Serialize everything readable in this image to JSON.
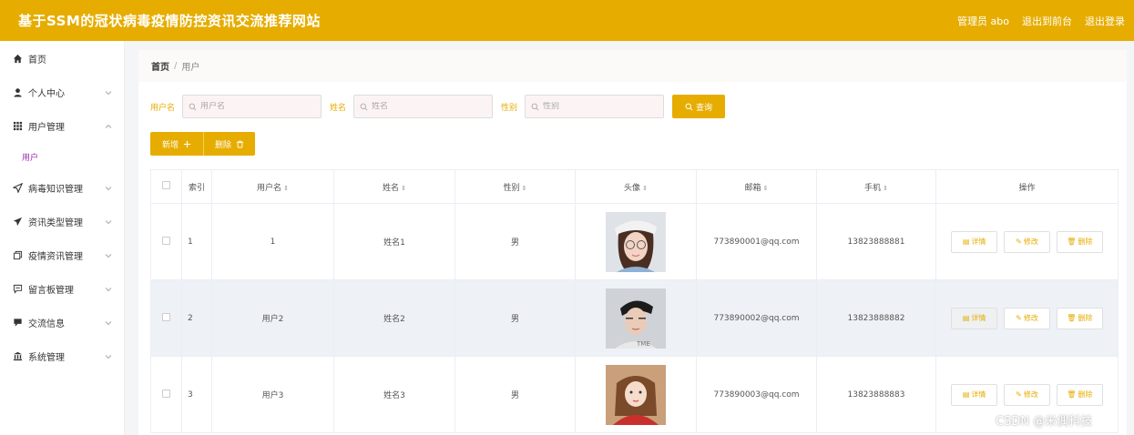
{
  "header": {
    "title": "基于SSM的冠状病毒疫情防控资讯交流推荐网站",
    "admin_label": "管理员 abo",
    "back_front": "退出到前台",
    "logout": "退出登录"
  },
  "sidebar": {
    "items": [
      {
        "label": "首页",
        "icon": "home-icon"
      },
      {
        "label": "个人中心",
        "icon": "user-icon"
      },
      {
        "label": "用户管理",
        "icon": "grid-icon",
        "expanded": true,
        "sub": "用户"
      },
      {
        "label": "病毒知识管理",
        "icon": "send-icon"
      },
      {
        "label": "资讯类型管理",
        "icon": "paper-plane-icon"
      },
      {
        "label": "疫情资讯管理",
        "icon": "copy-icon"
      },
      {
        "label": "留言板管理",
        "icon": "message-icon"
      },
      {
        "label": "交流信息",
        "icon": "chat-icon"
      },
      {
        "label": "系统管理",
        "icon": "bank-icon"
      }
    ]
  },
  "breadcrumb": {
    "home": "首页",
    "sep": "/",
    "current": "用户"
  },
  "filters": {
    "username_label": "用户名",
    "username_placeholder": "用户名",
    "name_label": "姓名",
    "name_placeholder": "姓名",
    "gender_label": "性别",
    "gender_placeholder": "性别",
    "query_label": "查询"
  },
  "actions": {
    "add_label": "新增",
    "delete_label": "删除"
  },
  "table": {
    "headers": {
      "index": "索引",
      "username": "用户名",
      "name": "姓名",
      "gender": "性别",
      "avatar": "头像",
      "email": "邮箱",
      "phone": "手机",
      "ops": "操作"
    },
    "rows": [
      {
        "index": "1",
        "username": "1",
        "name": "姓名1",
        "gender": "男",
        "email": "773890001@qq.com",
        "phone": "13823888881"
      },
      {
        "index": "2",
        "username": "用户2",
        "name": "姓名2",
        "gender": "男",
        "email": "773890002@qq.com",
        "phone": "13823888882"
      },
      {
        "index": "3",
        "username": "用户3",
        "name": "姓名3",
        "gender": "男",
        "email": "773890003@qq.com",
        "phone": "13823888883"
      }
    ],
    "op_detail": "详情",
    "op_edit": "修改",
    "op_delete": "删除"
  },
  "watermark": "CSDN @米偶科技",
  "colors": {
    "accent": "#e6ad00",
    "submenu_active": "#9b2cb3"
  }
}
